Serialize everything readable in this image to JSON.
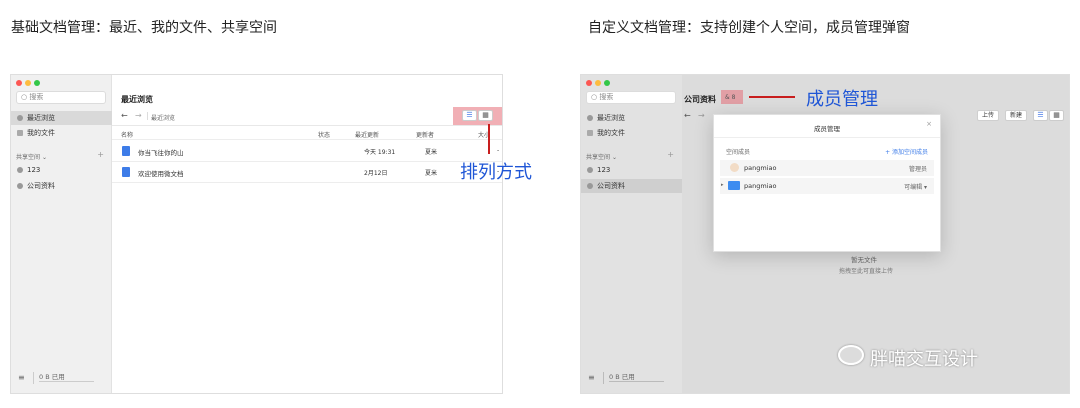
{
  "captions": {
    "left": "基础文档管理：最近、我的文件、共享空间",
    "right": "自定义文档管理：支持创建个人空间，成员管理弹窗"
  },
  "colors": {
    "annotation": "#1f56d6",
    "highlight": "#e66e78",
    "accent": "#3d7ce8",
    "traffic_red": "#fc5753",
    "traffic_yellow": "#fdbc40",
    "traffic_green": "#33c748"
  },
  "left_window": {
    "search_placeholder": "搜索",
    "nav": [
      "最近浏览",
      "我的文件"
    ],
    "shared_header": "共享空间",
    "shared_chevron": "⌄",
    "plus": "+",
    "spaces": [
      "123",
      "公司资料"
    ],
    "storage_icon": "≡",
    "storage": "0 B 已用",
    "page_title": "最近浏览",
    "back": "←",
    "forward": "→",
    "breadcrumb": "最近浏览",
    "view_list": "☰",
    "view_grid": "▦",
    "columns": {
      "name": "名称",
      "status": "状态",
      "updated": "最近更新",
      "updater": "更新者",
      "size": "大小"
    },
    "rows": [
      {
        "name": "你当飞往你的山",
        "updated": "今天 19:31",
        "updater": "夏米",
        "size": "-"
      },
      {
        "name": "欢迎使用微文档",
        "updated": "2月12日",
        "updater": "夏米",
        "size": "-"
      }
    ],
    "annotation": "排列方式"
  },
  "right_window": {
    "search_placeholder": "搜索",
    "nav": [
      "最近浏览",
      "我的文件"
    ],
    "shared_header": "共享空间",
    "shared_chevron": "⌄",
    "plus": "+",
    "spaces": [
      "123",
      "公司资料"
    ],
    "storage_icon": "≡",
    "storage": "0 B 已用",
    "page_title": "公司资料",
    "member_badge": "& 8",
    "back": "←",
    "forward": "→",
    "upload": "上传",
    "create": "新建",
    "view_list": "☰",
    "view_grid": "▦",
    "empty_title": "暂无文件",
    "empty_hint": "拖拽至此可直接上传",
    "annotation": "成员管理",
    "modal": {
      "title": "成员管理",
      "close": "×",
      "section": "空间成员",
      "add": "+ 添加空间成员",
      "members": [
        {
          "name": "pangmiao",
          "role": "管理员"
        },
        {
          "name": "pangmiao",
          "role": "可编辑 ▾"
        }
      ]
    }
  },
  "watermark": "胖喵交互设计"
}
